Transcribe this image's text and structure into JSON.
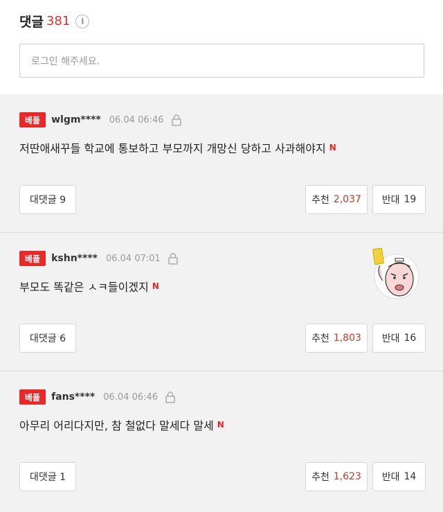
{
  "header": {
    "title": "댓글",
    "count": "381",
    "info": "i"
  },
  "login": {
    "placeholder": "로그인 해주세요."
  },
  "comments": [
    {
      "badge": "베플",
      "username": "wlgm****",
      "timestamp": "06.04 06:46",
      "text": "저딴애새꾸들 학교에 통보하고 부모까지 개망신 당하고 사과해야지",
      "new_mark": "N",
      "reply_label": "대댓글 9",
      "like_label": "추천",
      "like_count": "2,037",
      "dislike_label": "반대",
      "dislike_count": "19"
    },
    {
      "badge": "베플",
      "username": "kshn****",
      "timestamp": "06.04 07:01",
      "text": "부모도 똑같은 ㅅㅋ들이겠지",
      "new_mark": "N",
      "reply_label": "대댓글 6",
      "like_label": "추천",
      "like_count": "1,803",
      "dislike_label": "반대",
      "dislike_count": "16"
    },
    {
      "badge": "베플",
      "username": "fans****",
      "timestamp": "06.04 06:46",
      "text": "아무리 어리다지만, 참 철없다 말세다 말세",
      "new_mark": "N",
      "reply_label": "대댓글 1",
      "like_label": "추천",
      "like_count": "1,623",
      "dislike_label": "반대",
      "dislike_count": "14"
    }
  ],
  "colors": {
    "accent": "#e62a2a",
    "like_count": "#c0392b",
    "comment_bg": "#f2f2f2"
  },
  "icons": {
    "lock": "lock-icon",
    "info": "info-icon",
    "sticker": "yellow-card-sticker-icon"
  }
}
